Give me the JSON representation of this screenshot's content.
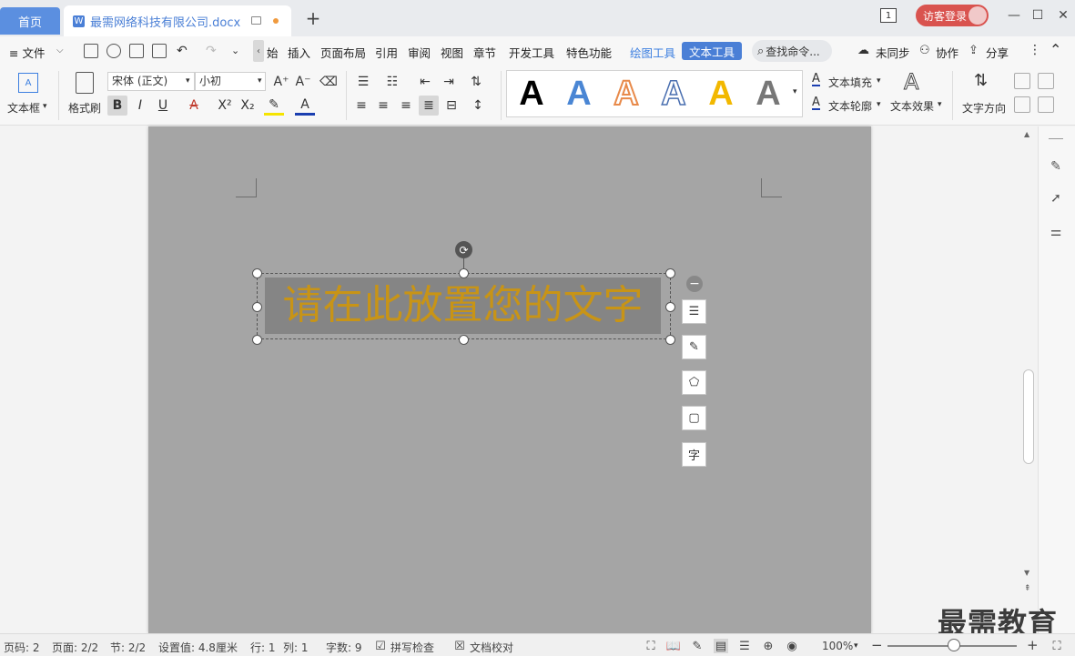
{
  "tabs": {
    "home": "首页",
    "doc_title": "最需网络科技有限公司.docx",
    "add": "+"
  },
  "window": {
    "badge": "1",
    "login": "访客登录",
    "minimize": "—",
    "maximize": "☐",
    "close": "✕"
  },
  "menu": {
    "file": "≡ 文件",
    "start": "始",
    "insert": "插入",
    "page_layout": "页面布局",
    "reference": "引用",
    "review": "审阅",
    "view": "视图",
    "section": "章节",
    "dev_tools": "开发工具",
    "special": "特色功能",
    "draw_tools": "绘图工具",
    "text_tools": "文本工具",
    "search": "查找命令...",
    "sync": "未同步",
    "collab": "协作",
    "share": "分享"
  },
  "ribbon": {
    "textbox_label": "文本框",
    "format_painter": "格式刷",
    "font_name": "宋体 (正文)",
    "font_size": "小初",
    "text_fill": "文本填充",
    "text_outline": "文本轮廓",
    "text_effect": "文本效果",
    "text_direction": "文字方向",
    "gallery_letter": "A"
  },
  "colors": {
    "accent": "#4a7fd6",
    "text_gold": "#c89416",
    "page": "#a5a5a5",
    "login": "#d9534f"
  },
  "document": {
    "textbox_text": "请在此放置您的文字"
  },
  "watermark": "最需教育",
  "status": {
    "page_num": "页码: 2",
    "page": "页面: 2/2",
    "section": "节: 2/2",
    "setting": "设置值: 4.8厘米",
    "row": "行: 1",
    "col": "列: 1",
    "words": "字数: 9",
    "spell_check": "拼写检查",
    "doc_check": "文档校对",
    "zoom": "100%"
  },
  "icons": {
    "rotate": "⟳",
    "minus": "−"
  }
}
